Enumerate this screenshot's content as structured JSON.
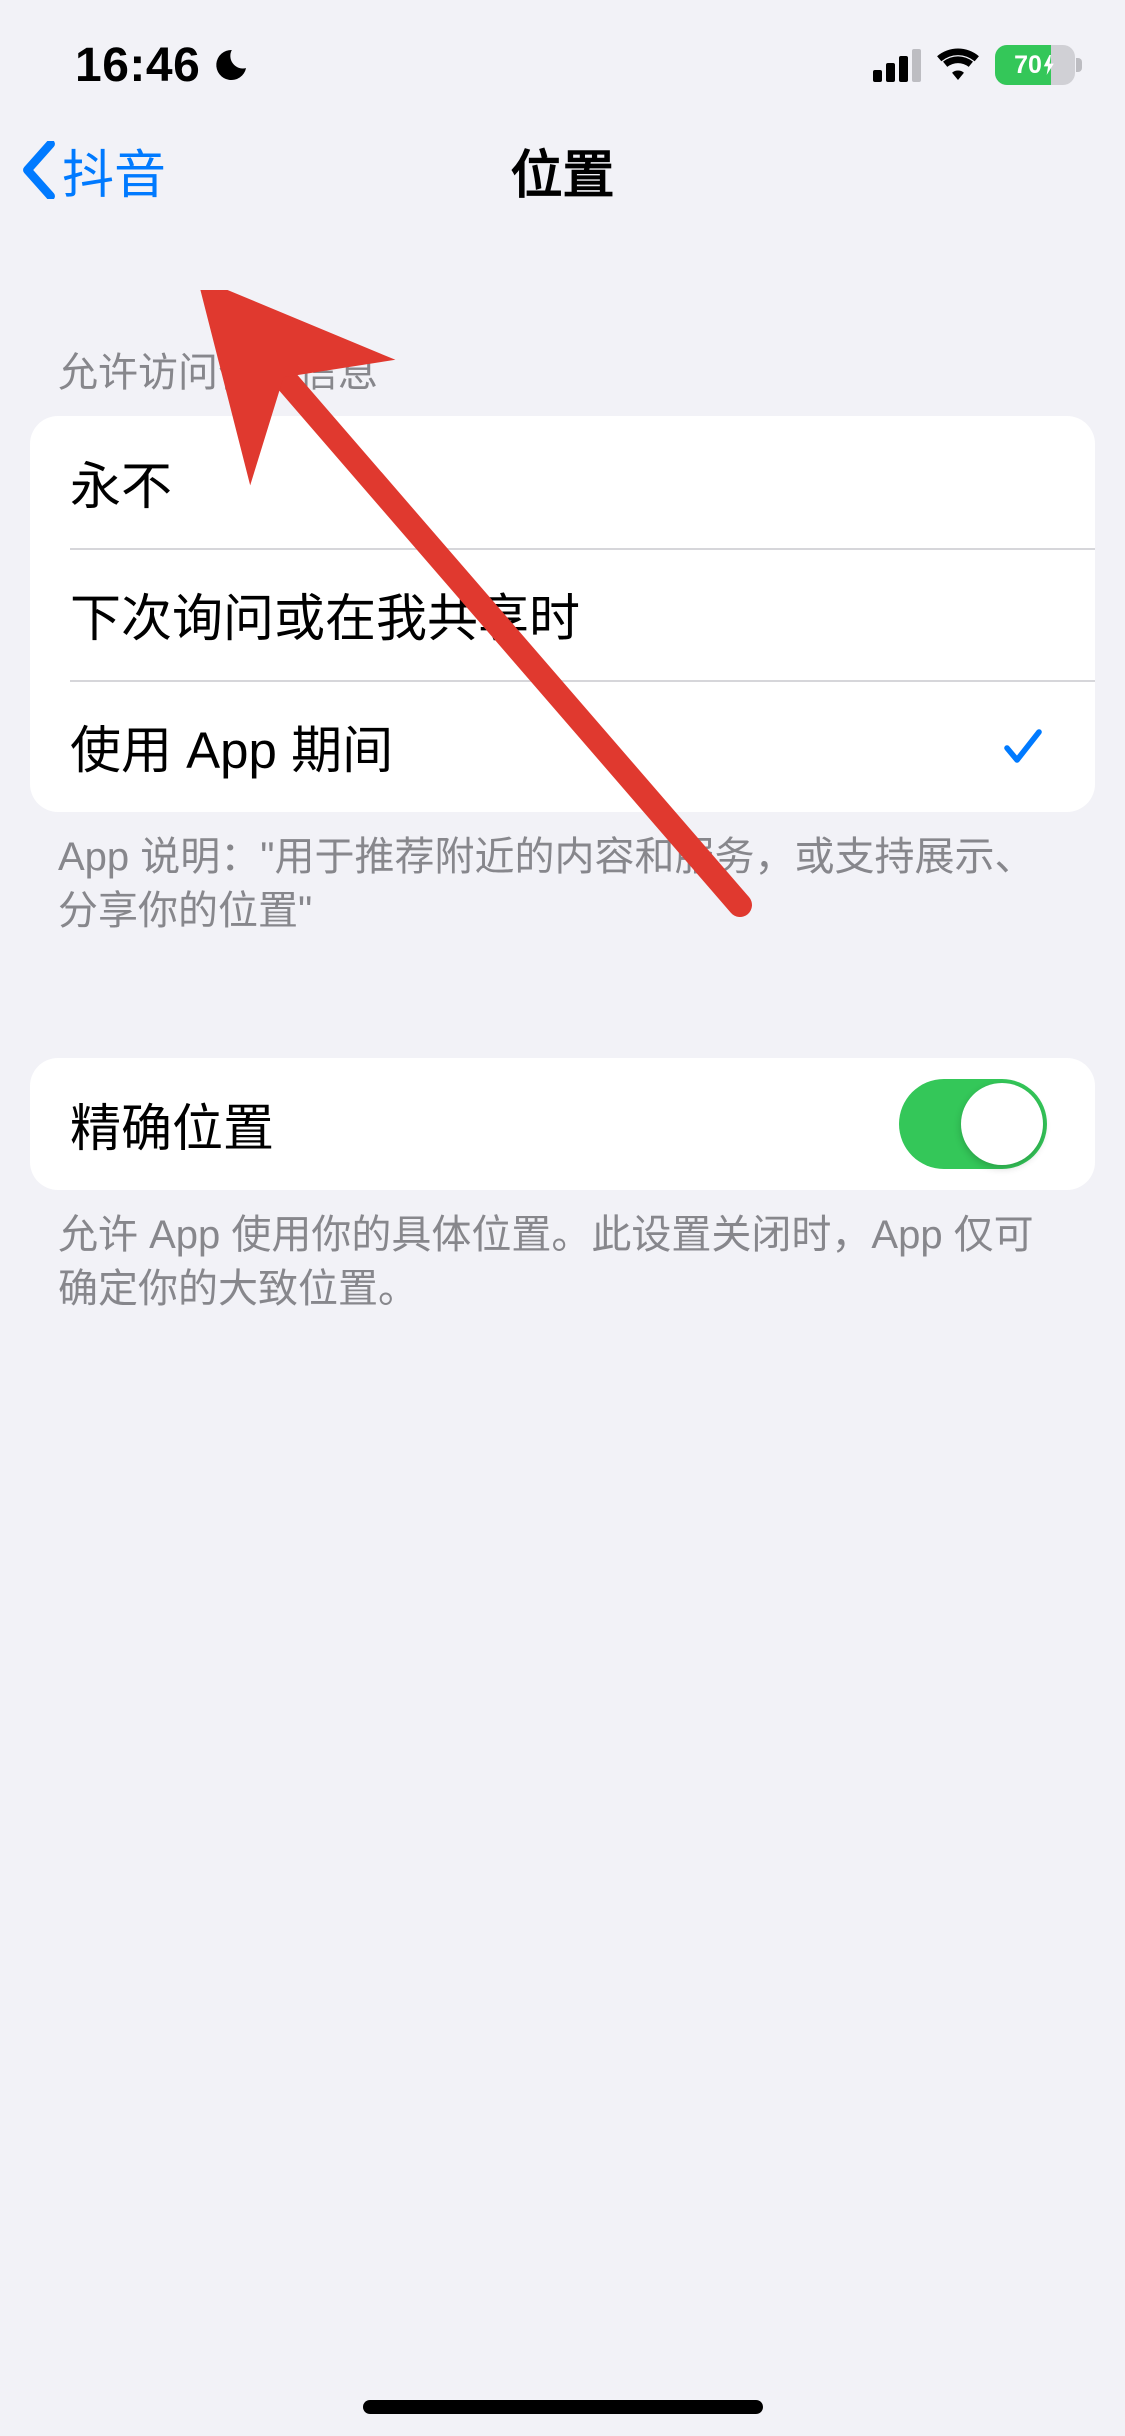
{
  "status": {
    "time": "16:46",
    "battery_text": "70"
  },
  "nav": {
    "back_label": "抖音",
    "title": "位置"
  },
  "location_access": {
    "header": "允许访问位置信息",
    "options": {
      "never": "永不",
      "ask_next_time": "下次询问或在我共享时",
      "while_using": "使用 App 期间"
    },
    "footer": "App 说明：\"用于推荐附近的内容和服务，或支持展示、分享你的位置\""
  },
  "precise": {
    "label": "精确位置",
    "footer": "允许 App 使用你的具体位置。此设置关闭时，App 仅可确定你的大致位置。"
  }
}
